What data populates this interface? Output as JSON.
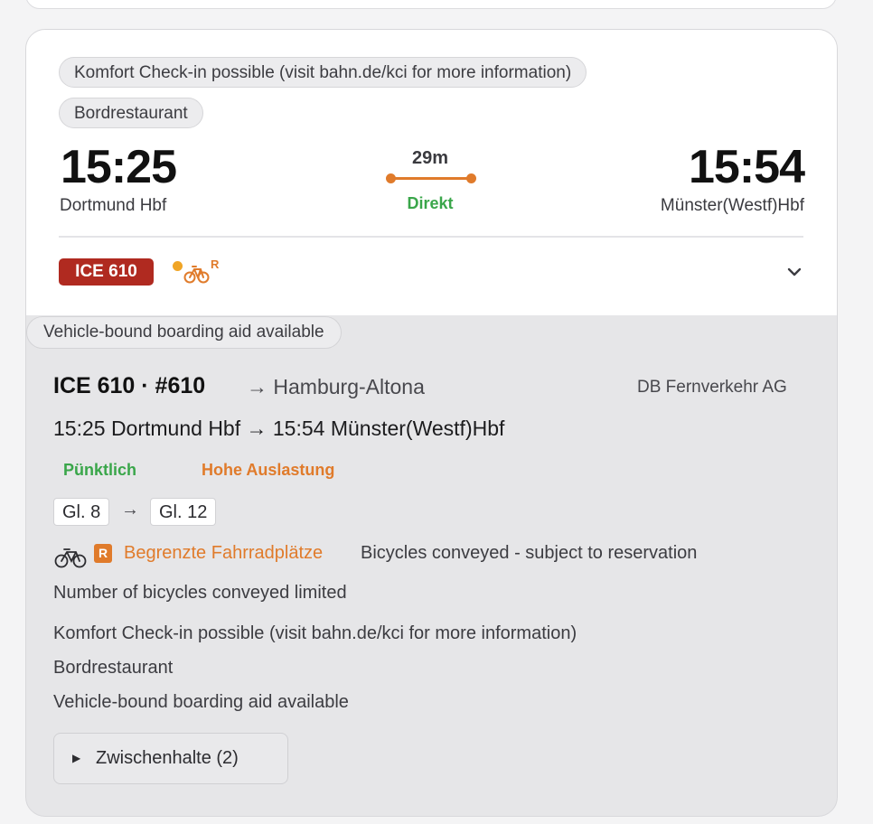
{
  "journey": {
    "notes": [
      "Komfort Check-in possible (visit bahn.de/kci for more information)",
      "Bordrestaurant"
    ],
    "departure": {
      "time": "15:25",
      "station": "Dortmund Hbf"
    },
    "arrival": {
      "time": "15:54",
      "station": "Münster(Westf)Hbf"
    },
    "duration": "29m",
    "connection_type": "Direkt",
    "train_badge": "ICE 610",
    "bike_indicator": "R",
    "colors": {
      "train_badge": "#b02a20",
      "accent_orange": "#e07b2b",
      "on_time_green": "#3aa64a"
    }
  },
  "details": {
    "boarding_note": "Vehicle-bound boarding aid available",
    "train_name": "ICE 610 · #610",
    "destination": "→ Hamburg-Altona",
    "operator": "DB Fernverkehr AG",
    "leg_summary": "15:25 Dortmund Hbf  →  15:54 Münster(Westf)Hbf",
    "status_on_time": "Pünktlich",
    "status_load": "Hohe Auslastung",
    "platform_from": "Gl. 8",
    "platform_arrow": "→",
    "platform_to": "Gl. 12",
    "bike_code": "R",
    "bike_limited": "Begrenzte Fahrradplätze",
    "bike_description": "Bicycles conveyed - subject to reservation",
    "remarks": [
      "Number of bicycles conveyed limited",
      "Komfort Check-in possible (visit bahn.de/kci for more information)",
      "Bordrestaurant",
      "Vehicle-bound boarding aid available"
    ],
    "stops_toggle": "Zwischenhalte (2)",
    "stops_toggle_icon": "▶"
  }
}
